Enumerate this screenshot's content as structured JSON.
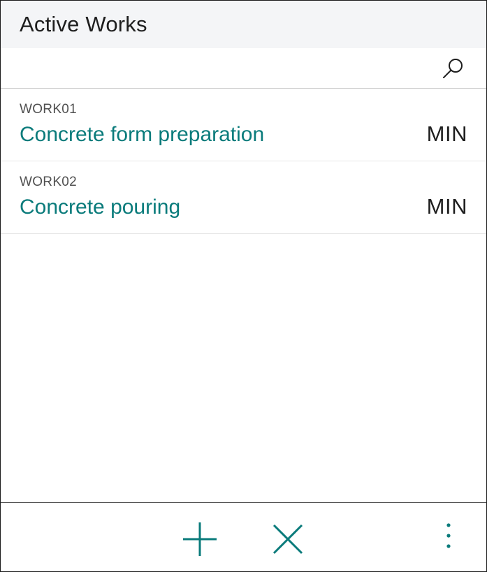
{
  "header": {
    "title": "Active Works"
  },
  "search": {
    "icon": "search-icon"
  },
  "works": [
    {
      "code": "WORK01",
      "description": "Concrete form preparation",
      "unit": "MIN"
    },
    {
      "code": "WORK02",
      "description": "Concrete pouring",
      "unit": "MIN"
    }
  ],
  "footer": {
    "icons": [
      "plus-icon",
      "close-icon",
      "more-vertical-icon"
    ]
  },
  "colors": {
    "accent": "#0a7b7b",
    "header_bg": "#f4f5f7",
    "text": "#1e1e1e"
  }
}
